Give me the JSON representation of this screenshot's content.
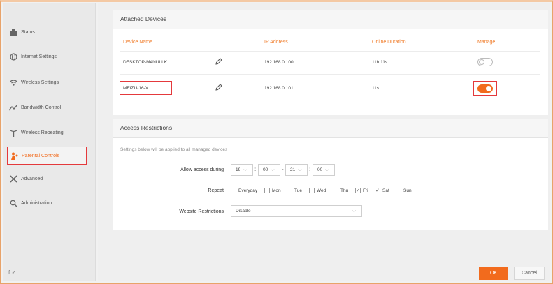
{
  "sidebar": {
    "items": [
      {
        "label": "Status",
        "icon": "status-icon"
      },
      {
        "label": "Internet Settings",
        "icon": "globe-icon"
      },
      {
        "label": "Wireless Settings",
        "icon": "wifi-icon"
      },
      {
        "label": "Bandwidth Control",
        "icon": "bandwidth-icon"
      },
      {
        "label": "Wireless Repeating",
        "icon": "repeater-icon"
      },
      {
        "label": "Parental Controls",
        "icon": "parental-icon",
        "active": true
      },
      {
        "label": "Advanced",
        "icon": "tools-icon"
      },
      {
        "label": "Administration",
        "icon": "admin-icon"
      }
    ],
    "footer": "f  ✓"
  },
  "attached": {
    "title": "Attached Devices",
    "headers": {
      "name": "Device Name",
      "ip": "IP Address",
      "online": "Online Duration",
      "manage": "Manage"
    },
    "rows": [
      {
        "name": "DESKTOP-M4NULLK",
        "ip": "192.168.0.100",
        "online": "11h 11s",
        "managed": false
      },
      {
        "name": "MEIZU-16-X",
        "ip": "192.168.0.101",
        "online": "11s",
        "managed": true
      }
    ]
  },
  "access": {
    "title": "Access Restrictions",
    "note": "Settings below will be applied to all managed devices",
    "allow_label": "Allow access during",
    "times": [
      "19",
      "00",
      "21",
      "00"
    ],
    "repeat_label": "Repeat",
    "days": [
      {
        "label": "Everyday",
        "checked": false
      },
      {
        "label": "Mon",
        "checked": false
      },
      {
        "label": "Tue",
        "checked": false
      },
      {
        "label": "Wed",
        "checked": false
      },
      {
        "label": "Thu",
        "checked": false
      },
      {
        "label": "Fri",
        "checked": true
      },
      {
        "label": "Sat",
        "checked": true
      },
      {
        "label": "Sun",
        "checked": false
      }
    ],
    "website_label": "Website Restrictions",
    "website_value": "Disable"
  },
  "footer": {
    "ok": "OK",
    "cancel": "Cancel"
  },
  "colors": {
    "accent": "#f26b1d",
    "highlight": "#e4393c"
  }
}
